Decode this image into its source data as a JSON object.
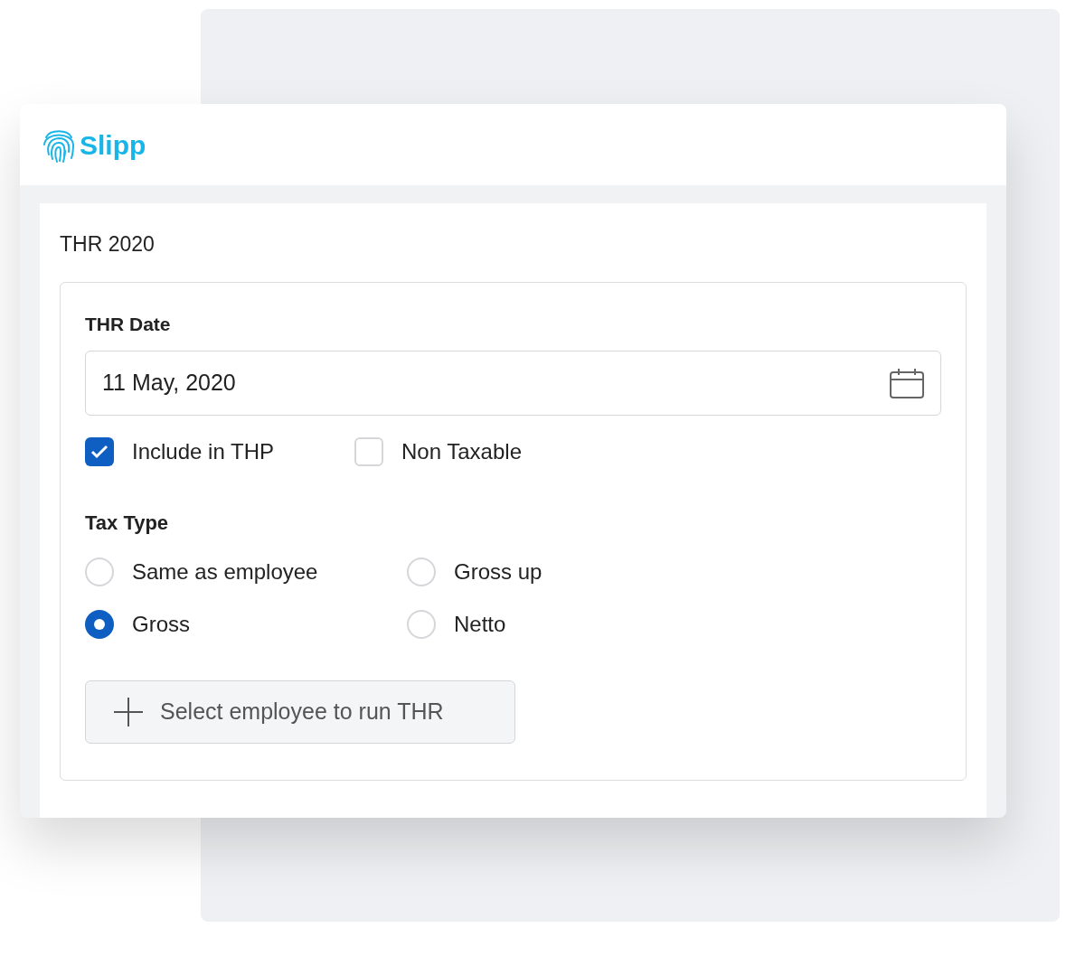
{
  "brand": "Slipp",
  "title": "THR 2020",
  "date_field": {
    "label": "THR Date",
    "value": "11 May, 2020"
  },
  "checkboxes": [
    {
      "label": "Include in THP",
      "checked": true
    },
    {
      "label": "Non Taxable",
      "checked": false
    }
  ],
  "tax_type": {
    "label": "Tax Type",
    "options": [
      {
        "label": "Same as employee",
        "selected": false
      },
      {
        "label": "Gross up",
        "selected": false
      },
      {
        "label": "Gross",
        "selected": true
      },
      {
        "label": "Netto",
        "selected": false
      }
    ]
  },
  "add_button": {
    "label": "Select employee to run THR"
  }
}
